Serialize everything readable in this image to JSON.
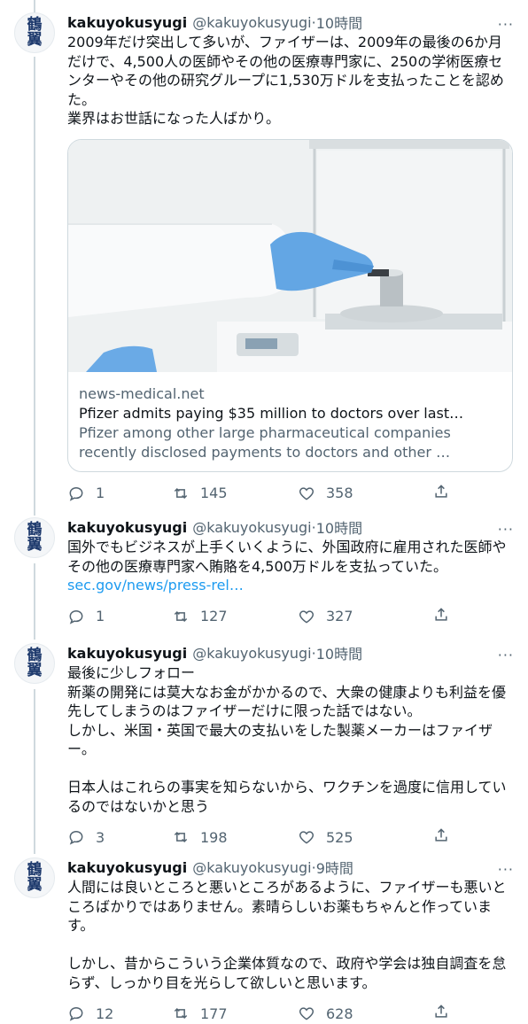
{
  "tweets": [
    {
      "name": "kakuyokusyugi",
      "handle": "@kakuyokusyugi",
      "time": "10時間",
      "avatar_text": [
        "鶴",
        "翼"
      ],
      "text": "2009年だけ突出して多いが、ファイザーは、2009年の最後の6か月だけで、4,500人の医師やその他の医療専門家に、250の学術医療センターやその他の研究グループに1,530万ドルを支払ったことを認めた。\n業界はお世話になった人ばかり。",
      "card": {
        "domain": "news-medical.net",
        "title": "Pfizer admits paying $35 million to doctors over last…",
        "desc_line1": "Pfizer among other large pharmaceutical companies",
        "desc_line2": "recently disclosed payments to doctors and other …"
      },
      "replies": "1",
      "retweets": "145",
      "likes": "358"
    },
    {
      "name": "kakuyokusyugi",
      "handle": "@kakuyokusyugi",
      "time": "10時間",
      "avatar_text": [
        "鶴",
        "翼"
      ],
      "text": "国外でもビジネスが上手くいくように、外国政府に雇用された医師やその他の医療専門家へ賄賂を4,500万ドルを支払っていた。",
      "link": "sec.gov/news/press-rel…",
      "replies": "1",
      "retweets": "127",
      "likes": "327"
    },
    {
      "name": "kakuyokusyugi",
      "handle": "@kakuyokusyugi",
      "time": "10時間",
      "avatar_text": [
        "鶴",
        "翼"
      ],
      "text": "最後に少しフォロー\n新薬の開発には莫大なお金がかかるので、大衆の健康よりも利益を優先してしまうのはファイザーだけに限った話ではない。\nしかし、米国・英国で最大の支払いをした製薬メーカーはファイザー。\n\n日本人はこれらの事実を知らないから、ワクチンを過度に信用しているのではないかと思う",
      "replies": "3",
      "retweets": "198",
      "likes": "525"
    },
    {
      "name": "kakuyokusyugi",
      "handle": "@kakuyokusyugi",
      "time": "9時間",
      "avatar_text": [
        "鶴",
        "翼"
      ],
      "text": "人間には良いところと悪いところがあるように、ファイザーも悪いところばかりではありません。素晴らしいお薬もちゃんと作っています。\n\nしかし、昔からこういう企業体質なので、政府や学会は独自調査を怠らず、しっかり目を光らして欲しいと思います。",
      "replies": "12",
      "retweets": "177",
      "likes": "628"
    }
  ],
  "more_label": "···",
  "separator": " · ",
  "icons": {
    "reply": "reply-icon",
    "retweet": "retweet-icon",
    "like": "heart-icon",
    "share": "share-icon",
    "more": "more-icon"
  },
  "colors": {
    "text": "#0f1419",
    "muted": "#536471",
    "link": "#1d9bf0",
    "thread_line": "#cfd9de",
    "avatar_ink": "#1e3a6d"
  }
}
